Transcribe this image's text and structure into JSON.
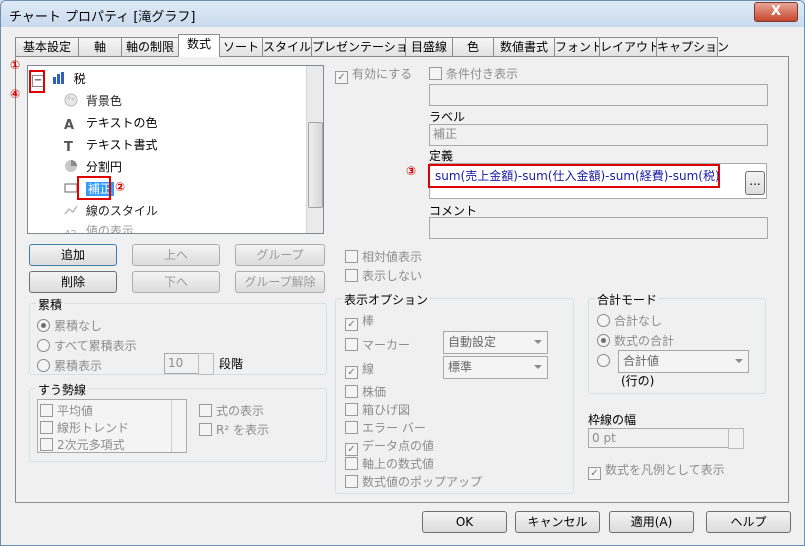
{
  "window": {
    "title": "チャート プロパティ [滝グラフ]",
    "close_label": "X"
  },
  "tabs": [
    "基本設定",
    "軸",
    "軸の制限",
    "数式",
    "ソート",
    "スタイル",
    "プレゼンテーション",
    "目盛線",
    "色",
    "数値書式",
    "フォント",
    "レイアウト",
    "キャプション"
  ],
  "active_tab": "数式",
  "tree": {
    "root_label": "税",
    "expander": "−",
    "items": [
      "背景色",
      "テキストの色",
      "テキスト書式",
      "分割円",
      "補正",
      "線のスタイル",
      "値の表示"
    ]
  },
  "buttons": {
    "add": "追加",
    "up": "上へ",
    "group": "グループ",
    "delete": "削除",
    "down": "下へ",
    "ungroup": "グループ解除",
    "ok": "OK",
    "cancel": "キャンセル",
    "apply": "適用(A)",
    "help": "ヘルプ"
  },
  "enable": {
    "label": "有効にする",
    "checked": true
  },
  "conditional": {
    "label": "条件付き表示",
    "checked": false
  },
  "label_field": {
    "label": "ラベル",
    "value": "補正"
  },
  "definition": {
    "label": "定義",
    "value": "sum(売上金額)-sum(仕入金額)-sum(経費)-sum(税)",
    "ellipsis": "..."
  },
  "comment": {
    "label": "コメント",
    "value": ""
  },
  "relative": {
    "label": "相対値表示"
  },
  "invisible": {
    "label": "表示しない"
  },
  "accumulation": {
    "title": "累積",
    "options": [
      "累積なし",
      "すべて累積表示",
      "累積表示"
    ],
    "selected": 0,
    "steps_value": "10",
    "steps_label": "段階"
  },
  "trendlines": {
    "title": "すう勢線",
    "items": [
      "平均値",
      "線形トレンド",
      "2次元多項式"
    ],
    "show_equation": "式の表示",
    "show_r2": "R² を表示"
  },
  "display_options": {
    "title": "表示オプション",
    "bar": "棒",
    "marker": "マーカー",
    "marker_value": "自動設定",
    "line": "線",
    "line_value": "標準",
    "stock": "株価",
    "box": "箱ひげ図",
    "error": "エラー バー",
    "values_on_data": "データ点の値",
    "values_on_axis": "軸上の数式値",
    "popup": "数式値のポップアップ",
    "checked": {
      "bar": true,
      "line": true,
      "values_on_data": true
    }
  },
  "total_mode": {
    "title": "合計モード",
    "options": [
      "合計なし",
      "数式の合計",
      "合計値"
    ],
    "selected": 1,
    "sub": "(行の)"
  },
  "border_width": {
    "label": "枠線の幅",
    "value": "0 pt"
  },
  "legend_check": {
    "label": "数式を凡例として表示",
    "checked": true
  },
  "annotations": [
    "①",
    "②",
    "③",
    "④"
  ],
  "colors": {
    "accent_red": "#e00000",
    "selection": "#3399ff",
    "formula_blue": "#1a1aa6"
  }
}
